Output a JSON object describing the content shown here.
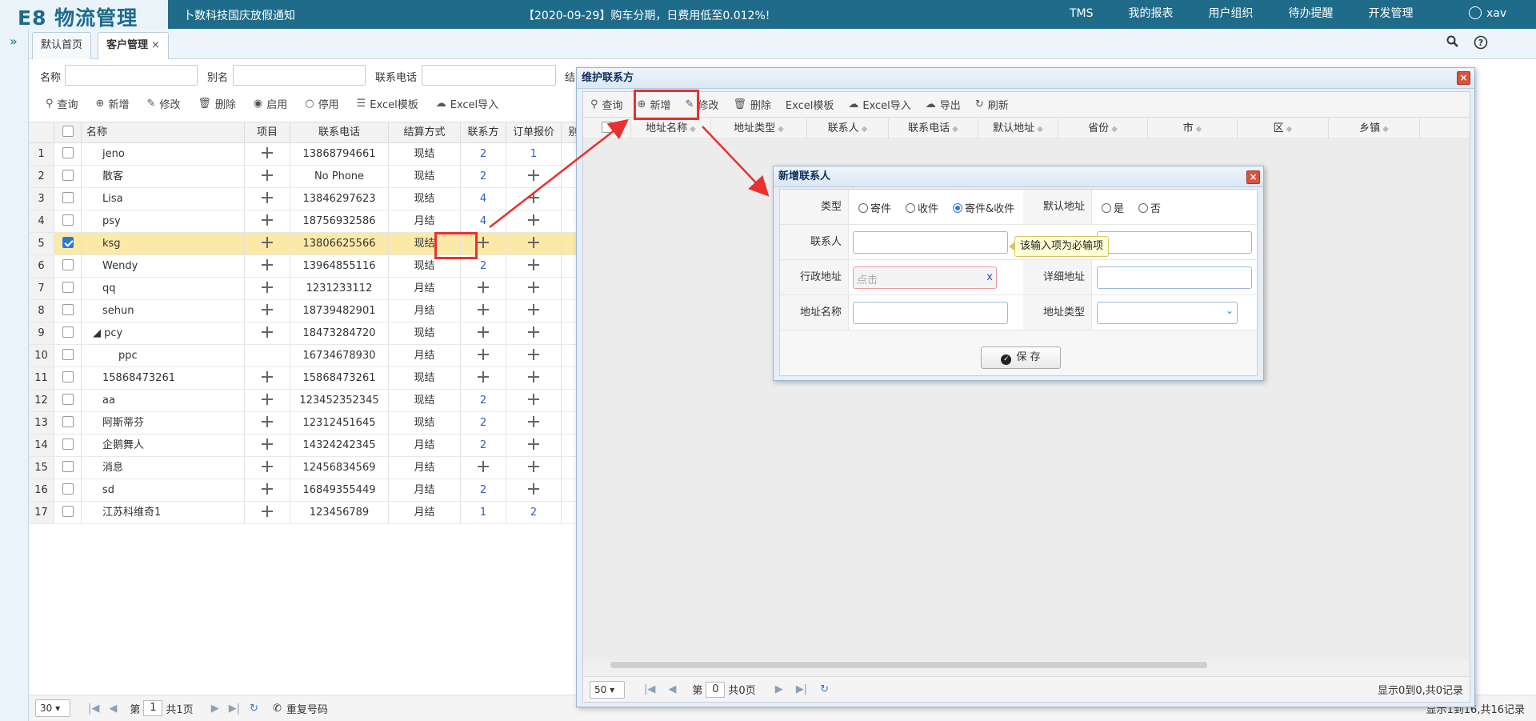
{
  "app": {
    "logo": "E8 物流管理",
    "notice_title": "卜数科技国庆放假通知",
    "notice_text": "【2020-09-29】购车分期，日费用低至0.012%!"
  },
  "topnav": [
    "TMS",
    "我的报表",
    "用户组织",
    "待办提醒",
    "开发管理"
  ],
  "user": {
    "name": "xav"
  },
  "tabs": [
    {
      "label": "默认首页"
    },
    {
      "label": "客户管理",
      "close": "×"
    }
  ],
  "search": {
    "name_label": "名称",
    "alias_label": "别名",
    "phone_label": "联系电话",
    "extra_label": "结"
  },
  "toolbar": [
    "查询",
    "新增",
    "修改",
    "删除",
    "启用",
    "停用",
    "Excel模板",
    "Excel导入"
  ],
  "grid": {
    "columns": [
      "名称",
      "项目",
      "联系电话",
      "结算方式",
      "联系方",
      "订单报价",
      "别"
    ],
    "rows": [
      {
        "n": "1",
        "name": "jeno",
        "phone": "13868794661",
        "settle": "现结",
        "contact": "2",
        "quote": "1"
      },
      {
        "n": "2",
        "name": "散客",
        "phone": "No Phone",
        "settle": "现结",
        "contact": "2",
        "quote": "+"
      },
      {
        "n": "3",
        "name": "Lisa",
        "phone": "13846297623",
        "settle": "现结",
        "contact": "4",
        "quote": "+"
      },
      {
        "n": "4",
        "name": "psy",
        "phone": "18756932586",
        "settle": "月结",
        "contact": "4",
        "quote": "+"
      },
      {
        "n": "5",
        "name": "ksg",
        "phone": "13806625566",
        "settle": "现结",
        "contact": "+",
        "quote": "+",
        "selected": true
      },
      {
        "n": "6",
        "name": "Wendy",
        "phone": "13964855116",
        "settle": "现结",
        "contact": "2",
        "quote": "+"
      },
      {
        "n": "7",
        "name": "qq",
        "phone": "1231233112",
        "settle": "月结",
        "contact": "+",
        "quote": "+"
      },
      {
        "n": "8",
        "name": "sehun",
        "phone": "18739482901",
        "settle": "月结",
        "contact": "+",
        "quote": "+"
      },
      {
        "n": "9",
        "name": "◢ pcy",
        "phone": "18473284720",
        "settle": "现结",
        "contact": "+",
        "quote": "+"
      },
      {
        "n": "10",
        "name": "ppc",
        "phone": "16734678930",
        "settle": "月结",
        "contact": "+",
        "quote": "+",
        "child": true
      },
      {
        "n": "11",
        "name": "15868473261",
        "phone": "15868473261",
        "settle": "现结",
        "contact": "+",
        "quote": "+"
      },
      {
        "n": "12",
        "name": "aa",
        "phone": "123452352345",
        "settle": "现结",
        "contact": "2",
        "quote": "+"
      },
      {
        "n": "13",
        "name": "阿斯蒂芬",
        "phone": "12312451645",
        "settle": "现结",
        "contact": "2",
        "quote": "+"
      },
      {
        "n": "14",
        "name": "企鹅舞人",
        "phone": "14324242345",
        "settle": "月结",
        "contact": "2",
        "quote": "+"
      },
      {
        "n": "15",
        "name": "消息",
        "phone": "12456834569",
        "settle": "月结",
        "contact": "+",
        "quote": "+"
      },
      {
        "n": "16",
        "name": "sd",
        "phone": "16849355449",
        "settle": "月结",
        "contact": "2",
        "quote": "+"
      },
      {
        "n": "17",
        "name": "江苏科维奇1",
        "phone": "123456789",
        "settle": "月结",
        "contact": "1",
        "quote": "2"
      }
    ]
  },
  "pager": {
    "size": "30",
    "page_prefix": "第",
    "page": "1",
    "page_total": "共1页",
    "reset": "重复号码",
    "summary": "显示1到16,共16记录"
  },
  "dialog": {
    "title": "维护联系方",
    "toolbar": [
      "查询",
      "新增",
      "修改",
      "删除",
      "Excel模板",
      "Excel导入",
      "导出",
      "刷新"
    ],
    "columns": [
      "地址名称",
      "地址类型",
      "联系人",
      "联系电话",
      "默认地址",
      "省份",
      "市",
      "区",
      "乡镇"
    ],
    "pager": {
      "size": "50",
      "page_prefix": "第",
      "page": "0",
      "page_total": "共0页",
      "summary": "显示0到0,共0记录"
    }
  },
  "subdialog": {
    "title": "新增联系人",
    "type_label": "类型",
    "type_options": [
      "寄件",
      "收件",
      "寄件&收件"
    ],
    "default_label": "默认地址",
    "default_options": [
      "是",
      "否"
    ],
    "contact_label": "联系人",
    "tooltip": "该输入项为必输项",
    "region_label": "行政地址",
    "region_placeholder": "点击",
    "region_clear": "x",
    "detail_label": "详细地址",
    "addrname_label": "地址名称",
    "addrtype_label": "地址类型",
    "save_label": "保 存"
  }
}
